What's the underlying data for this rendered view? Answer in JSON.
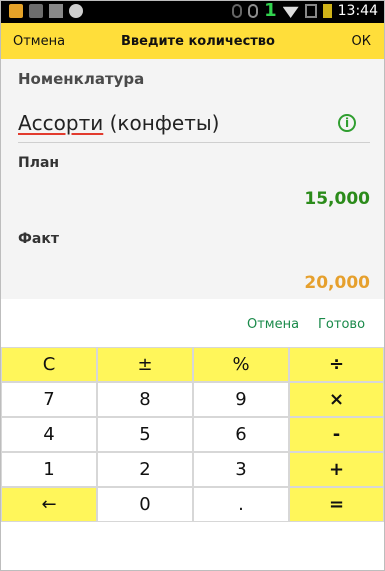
{
  "status_bar": {
    "time": "13:44",
    "sim_number": "1"
  },
  "top_bar": {
    "cancel": "Отмена",
    "title": "Введите количество",
    "ok": "ОК"
  },
  "fields": {
    "nomenclature_label": "Номенклатура",
    "nomenclature_value_main": "Ассорти",
    "nomenclature_value_rest": "(конфеты)",
    "plan_label": "План",
    "plan_value": "15,000",
    "fact_label": "Факт",
    "fact_value": "20,000"
  },
  "actions": {
    "cancel": "Отмена",
    "done": "Готово"
  },
  "keypad": {
    "row1": [
      "C",
      "±",
      "%",
      "÷"
    ],
    "row2": [
      "7",
      "8",
      "9",
      "×"
    ],
    "row3": [
      "4",
      "5",
      "6",
      "-"
    ],
    "row4": [
      "1",
      "2",
      "3",
      "+"
    ],
    "row5": [
      "←",
      "0",
      ".",
      "="
    ]
  }
}
